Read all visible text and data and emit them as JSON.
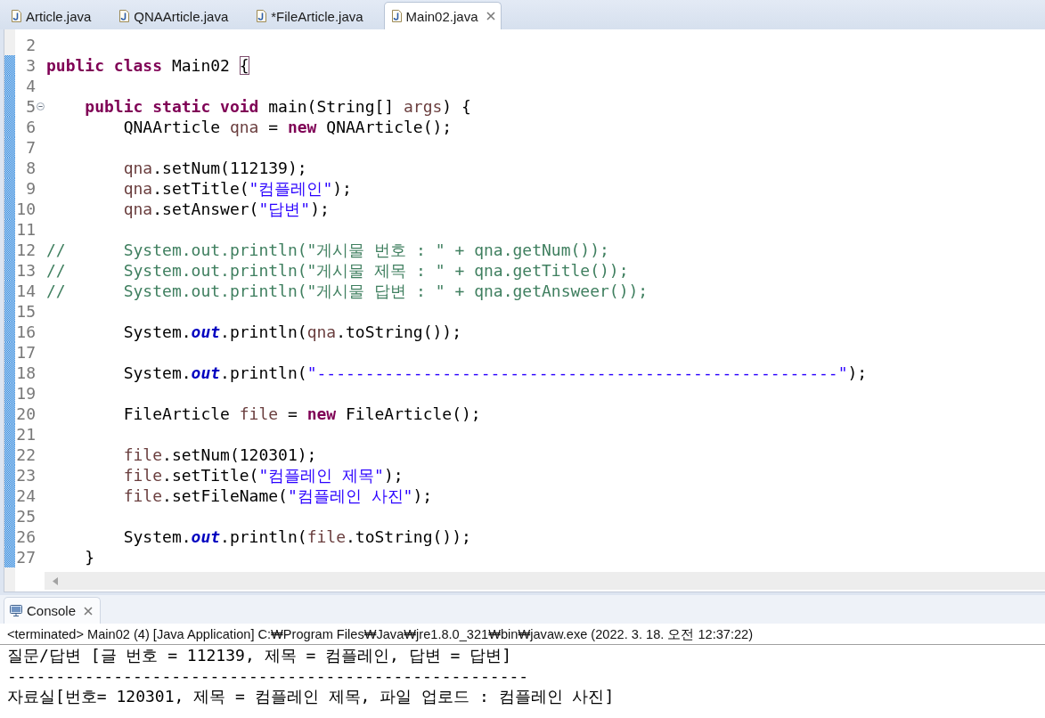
{
  "editor_tabs": [
    {
      "label": "Article.java",
      "selected": false
    },
    {
      "label": "QNAArticle.java",
      "selected": false
    },
    {
      "label": "*FileArticle.java",
      "selected": false
    },
    {
      "label": "Main02.java",
      "selected": true
    }
  ],
  "editor": {
    "lines": [
      {
        "number": "2",
        "in_range": false
      },
      {
        "number": "3",
        "in_range": true,
        "tokens": [
          {
            "text": "public class",
            "kind": "keyword"
          },
          {
            "text": " Main02 ",
            "kind": "plain"
          },
          {
            "text": "{",
            "kind": "bracket"
          }
        ]
      },
      {
        "number": "4",
        "in_range": true
      },
      {
        "number": "5",
        "in_range": true,
        "fold_expanded": true,
        "tokens": [
          {
            "text": "    public static void",
            "kind": "keyword"
          },
          {
            "text": " main(String[] ",
            "kind": "plain"
          },
          {
            "text": "args",
            "kind": "local"
          },
          {
            "text": ") {",
            "kind": "plain"
          }
        ]
      },
      {
        "number": "6",
        "in_range": true,
        "tokens": [
          {
            "text": "        QNAArticle ",
            "kind": "plain"
          },
          {
            "text": "qna",
            "kind": "local"
          },
          {
            "text": " = ",
            "kind": "plain"
          },
          {
            "text": "new",
            "kind": "keyword"
          },
          {
            "text": " QNAArticle();",
            "kind": "plain"
          }
        ]
      },
      {
        "number": "7",
        "in_range": true
      },
      {
        "number": "8",
        "in_range": true,
        "tokens": [
          {
            "text": "        qna",
            "kind": "local"
          },
          {
            "text": ".setNum(112139);",
            "kind": "plain"
          }
        ]
      },
      {
        "number": "9",
        "in_range": true,
        "tokens": [
          {
            "text": "        qna",
            "kind": "local"
          },
          {
            "text": ".setTitle(",
            "kind": "plain"
          },
          {
            "text": "\"컴플레인\"",
            "kind": "string"
          },
          {
            "text": ");",
            "kind": "plain"
          }
        ]
      },
      {
        "number": "10",
        "in_range": true,
        "tokens": [
          {
            "text": "        qna",
            "kind": "local"
          },
          {
            "text": ".setAnswer(",
            "kind": "plain"
          },
          {
            "text": "\"답변\"",
            "kind": "string"
          },
          {
            "text": ");",
            "kind": "plain"
          }
        ]
      },
      {
        "number": "11",
        "in_range": true
      },
      {
        "number": "12",
        "in_range": true,
        "tokens": [
          {
            "text": "//      System.out.println(\"게시물 번호 : \" + qna.getNum());",
            "kind": "comment"
          }
        ]
      },
      {
        "number": "13",
        "in_range": true,
        "tokens": [
          {
            "text": "//      System.out.println(\"게시물 제목 : \" + qna.getTitle());",
            "kind": "comment"
          }
        ]
      },
      {
        "number": "14",
        "in_range": true,
        "tokens": [
          {
            "text": "//      System.out.println(\"게시물 답변 : \" + qna.getAnsweer());",
            "kind": "comment"
          }
        ]
      },
      {
        "number": "15",
        "in_range": true
      },
      {
        "number": "16",
        "in_range": true,
        "tokens": [
          {
            "text": "        System.",
            "kind": "plain"
          },
          {
            "text": "out",
            "kind": "field"
          },
          {
            "text": ".println(",
            "kind": "plain"
          },
          {
            "text": "qna",
            "kind": "local"
          },
          {
            "text": ".toString());",
            "kind": "plain"
          }
        ]
      },
      {
        "number": "17",
        "in_range": true
      },
      {
        "number": "18",
        "in_range": true,
        "tokens": [
          {
            "text": "        System.",
            "kind": "plain"
          },
          {
            "text": "out",
            "kind": "field"
          },
          {
            "text": ".println(",
            "kind": "plain"
          },
          {
            "text": "\"------------------------------------------------------\"",
            "kind": "string"
          },
          {
            "text": ");",
            "kind": "plain"
          }
        ]
      },
      {
        "number": "19",
        "in_range": true
      },
      {
        "number": "20",
        "in_range": true,
        "tokens": [
          {
            "text": "        FileArticle ",
            "kind": "plain"
          },
          {
            "text": "file",
            "kind": "local"
          },
          {
            "text": " = ",
            "kind": "plain"
          },
          {
            "text": "new",
            "kind": "keyword"
          },
          {
            "text": " FileArticle();",
            "kind": "plain"
          }
        ]
      },
      {
        "number": "21",
        "in_range": true
      },
      {
        "number": "22",
        "in_range": true,
        "tokens": [
          {
            "text": "        file",
            "kind": "local"
          },
          {
            "text": ".setNum(120301);",
            "kind": "plain"
          }
        ]
      },
      {
        "number": "23",
        "in_range": true,
        "tokens": [
          {
            "text": "        file",
            "kind": "local"
          },
          {
            "text": ".setTitle(",
            "kind": "plain"
          },
          {
            "text": "\"컴플레인 제목\"",
            "kind": "string"
          },
          {
            "text": ");",
            "kind": "plain"
          }
        ]
      },
      {
        "number": "24",
        "in_range": true,
        "tokens": [
          {
            "text": "        file",
            "kind": "local"
          },
          {
            "text": ".setFileName(",
            "kind": "plain"
          },
          {
            "text": "\"컴플레인 사진\"",
            "kind": "string"
          },
          {
            "text": ");",
            "kind": "plain"
          }
        ]
      },
      {
        "number": "25",
        "in_range": true
      },
      {
        "number": "26",
        "in_range": true,
        "tokens": [
          {
            "text": "        System.",
            "kind": "plain"
          },
          {
            "text": "out",
            "kind": "field"
          },
          {
            "text": ".println(",
            "kind": "plain"
          },
          {
            "text": "file",
            "kind": "local"
          },
          {
            "text": ".toString());",
            "kind": "plain"
          }
        ]
      },
      {
        "number": "27",
        "in_range": true,
        "tokens": [
          {
            "text": "    }",
            "kind": "plain"
          }
        ]
      }
    ]
  },
  "console": {
    "tab": {
      "label": "Console",
      "selected": true
    },
    "status": "<terminated> Main02 (4) [Java Application] C:₩Program Files₩Java₩jre1.8.0_321₩bin₩javaw.exe (2022. 3. 18. 오전 12:37:22)",
    "output": [
      "질문/답변 [글 번호 = 112139, 제목 = 컴플레인, 답변 = 답변]",
      "------------------------------------------------------",
      "자료실[번호= 120301, 제목 = 컴플레인 제목, 파일 업로드 : 컴플레인 사진]"
    ]
  }
}
